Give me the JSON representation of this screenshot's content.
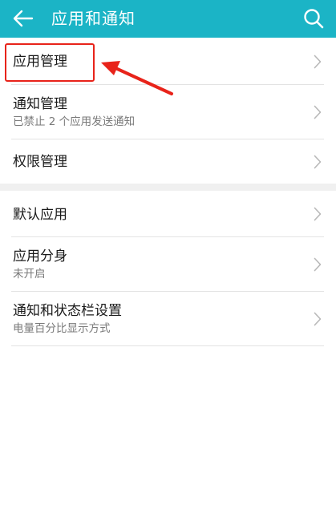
{
  "header": {
    "title": "应用和通知",
    "back_icon": "arrow-left-icon",
    "search_icon": "search-icon",
    "background": "#1bb4c6"
  },
  "sections": [
    {
      "items": [
        {
          "label": "应用管理",
          "subtitle": ""
        },
        {
          "label": "通知管理",
          "subtitle": "已禁止 2 个应用发送通知"
        },
        {
          "label": "权限管理",
          "subtitle": ""
        }
      ]
    },
    {
      "items": [
        {
          "label": "默认应用",
          "subtitle": ""
        },
        {
          "label": "应用分身",
          "subtitle": "未开启"
        },
        {
          "label": "通知和状态栏设置",
          "subtitle": "电量百分比显示方式"
        }
      ]
    }
  ],
  "annotation": {
    "color": "#e8231a"
  }
}
